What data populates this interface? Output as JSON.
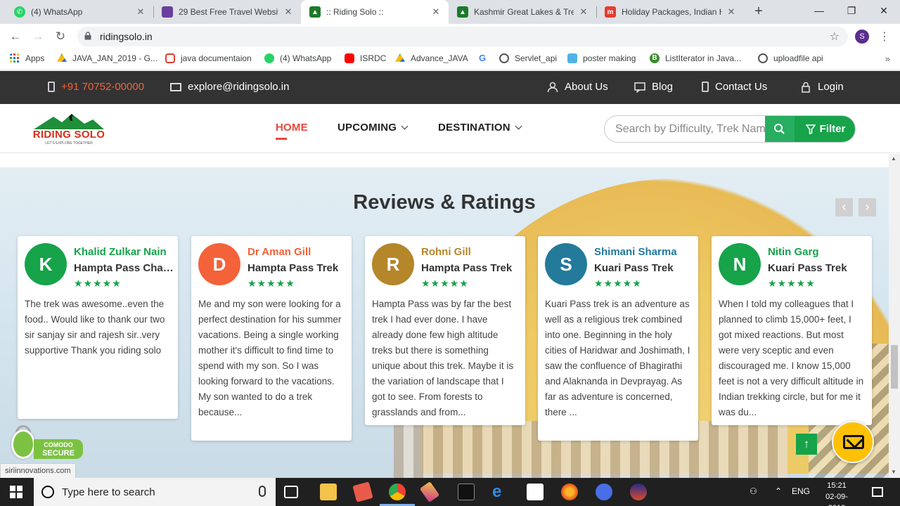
{
  "browser": {
    "tabs": [
      {
        "title": "(4) WhatsApp",
        "favicon": "whatsapp-icon",
        "color": "#25d366"
      },
      {
        "title": "29 Best Free Travel Website",
        "favicon": "colorlib-icon",
        "color": "#6a3fa0"
      },
      {
        "title": ":: Riding Solo ::",
        "favicon": "ridingsolo-icon",
        "color": "#1b7a2a"
      },
      {
        "title": "Kashmir Great Lakes & Trek",
        "favicon": "ridingsolo-icon",
        "color": "#1b7a2a"
      },
      {
        "title": "Holiday Packages, Indian H",
        "favicon": "makemytrip-icon",
        "color": "#e63b2e"
      }
    ],
    "url": "ridingsolo.in",
    "profile_initial": "S",
    "bookmarks": [
      {
        "label": "Apps",
        "icon": "apps-grid-icon"
      },
      {
        "label": "JAVA_JAN_2019 - G...",
        "icon": "google-drive-icon"
      },
      {
        "label": "java documentaion",
        "icon": "oracle-icon"
      },
      {
        "label": "(4) WhatsApp",
        "icon": "whatsapp-icon"
      },
      {
        "label": "ISRDC",
        "icon": "youtube-icon"
      },
      {
        "label": "Advance_JAVA",
        "icon": "google-drive-icon"
      },
      {
        "label": "",
        "icon": "google-icon"
      },
      {
        "label": "Servlet_api",
        "icon": "globe-icon"
      },
      {
        "label": "poster making",
        "icon": "bookmark-page-icon"
      },
      {
        "label": "ListIterator in Java...",
        "icon": "bing-icon"
      },
      {
        "label": "uploadfile api",
        "icon": "globe-icon"
      }
    ]
  },
  "topbar": {
    "phone": "+91 70752-00000",
    "email": "explore@ridingsolo.in",
    "links": [
      "About Us",
      "Blog",
      "Contact Us",
      "Login"
    ]
  },
  "header": {
    "logo_text": "RIDING SOLO",
    "logo_tagline": "LET'S EXPLORE TOGETHER",
    "nav": [
      "HOME",
      "UPCOMING",
      "DESTINATION"
    ],
    "search_placeholder": "Search by Difficulty, Trek Name",
    "filter_label": "Filter"
  },
  "reviews": {
    "title": "Reviews & Ratings",
    "prev": "‹",
    "next": "›",
    "cards": [
      {
        "initial": "K",
        "name": "Khalid Zulkar Nain",
        "trek": "Hampta Pass Challenge Trek",
        "stars": "★★★★★",
        "color": "#16a34a",
        "name_color": "#16a34a",
        "text": "The trek was awesome..even the food.. Would like to thank our two sir sanjay sir and rajesh sir..very supportive Thank you riding solo"
      },
      {
        "initial": "D",
        "name": "Dr Aman Gill",
        "trek": "Hampta Pass Trek",
        "stars": "★★★★★",
        "color": "#f4623a",
        "name_color": "#f4623a",
        "text": "Me and my son were looking for a perfect destination for his summer vacations. Being a single working mother it's difficult to find time to spend with my son. So I was looking forward to the vacations. My son wanted to do a trek because..."
      },
      {
        "initial": "R",
        "name": "Rohni Gill",
        "trek": "Hampta Pass Trek",
        "stars": "★★★★★",
        "color": "#b5862a",
        "name_color": "#b5862a",
        "text": "Hampta Pass was by far the best trek I had ever done. I have already done few high altitude treks but there is something unique about this trek. Maybe it is the variation of landscape that I got to see. From forests to grasslands and from..."
      },
      {
        "initial": "S",
        "name": "Shimani Sharma",
        "trek": "Kuari Pass Trek",
        "stars": "★★★★★",
        "color": "#237a9a",
        "name_color": "#237a9a",
        "text": "Kuari Pass trek is an adventure as well as a religious trek combined into one. Beginning in the holy cities of Haridwar and Joshimath, I saw the confluence of Bhagirathi and Alaknanda in Devprayag. As far as adventure is concerned, there ..."
      },
      {
        "initial": "N",
        "name": "Nitin Garg",
        "trek": "Kuari Pass Trek",
        "stars": "★★★★★",
        "color": "#16a34a",
        "name_color": "#16a34a",
        "text": "When I told my colleagues that I planned to climb 15,000+ feet, I got mixed reactions. But most were very sceptic and even discouraged me. I know 15,000 feet is not a very difficult altitude in Indian trekking circle, but for me it was du..."
      }
    ]
  },
  "badge": {
    "line1": "COMODO",
    "line2": "SECURE"
  },
  "status_url": "siriinnovations.com",
  "taskbar": {
    "search_placeholder": "Type here to search",
    "lang": "ENG",
    "time": "15:21",
    "date": "02-09-2019"
  }
}
